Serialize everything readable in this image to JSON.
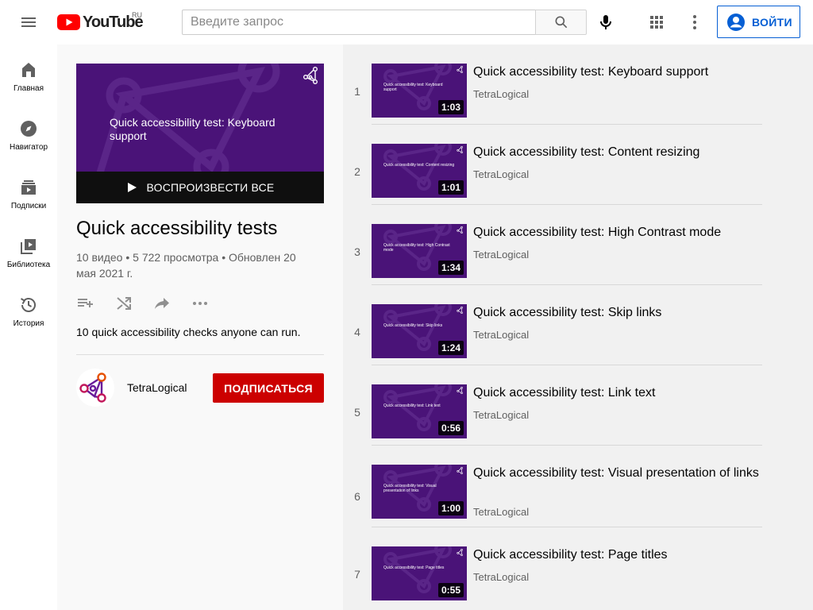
{
  "header": {
    "logo_text": "YouTube",
    "logo_region": "RU",
    "search_placeholder": "Введите запрос",
    "signin_label": "ВОЙТИ"
  },
  "guide": {
    "items": [
      {
        "label": "Главная",
        "icon": "home-icon"
      },
      {
        "label": "Навигатор",
        "icon": "compass-icon"
      },
      {
        "label": "Подписки",
        "icon": "subscriptions-icon"
      },
      {
        "label": "Библиотека",
        "icon": "library-icon"
      },
      {
        "label": "История",
        "icon": "history-icon"
      }
    ]
  },
  "playlist": {
    "thumb_text": "Quick accessibility test: Keyboard support",
    "play_all_label": "ВОСПРОИЗВЕСТИ ВСЕ",
    "title": "Quick accessibility tests",
    "stats": "10 видео • 5 722 просмотра • Обновлен 20 мая 2021 г.",
    "description": "10 quick accessibility checks anyone can run.",
    "owner_name": "TetraLogical",
    "subscribe_label": "ПОДПИСАТЬСЯ",
    "colors": {
      "thumb_bg": "#4a1378",
      "subscribe": "#cc0000",
      "accent": "#065fd4"
    }
  },
  "videos": [
    {
      "index": "1",
      "title": "Quick accessibility test: Keyboard support",
      "channel": "TetraLogical",
      "duration": "1:03",
      "thumb_text": "Quick accessibility test: Keyboard support"
    },
    {
      "index": "2",
      "title": "Quick accessibility test: Content resizing",
      "channel": "TetraLogical",
      "duration": "1:01",
      "thumb_text": "Quick accessibility test: Content resizing"
    },
    {
      "index": "3",
      "title": "Quick accessibility test: High Contrast mode",
      "channel": "TetraLogical",
      "duration": "1:34",
      "thumb_text": "Quick accessibility test: High Contrast mode"
    },
    {
      "index": "4",
      "title": "Quick accessibility test: Skip links",
      "channel": "TetraLogical",
      "duration": "1:24",
      "thumb_text": "Quick accessibility test: Skip links"
    },
    {
      "index": "5",
      "title": "Quick accessibility test: Link text",
      "channel": "TetraLogical",
      "duration": "0:56",
      "thumb_text": "Quick accessibility test: Link text"
    },
    {
      "index": "6",
      "title": "Quick accessibility test: Visual presentation of links",
      "channel": "TetraLogical",
      "duration": "1:00",
      "thumb_text": "Quick accessibility test: Visual presentation of links"
    },
    {
      "index": "7",
      "title": "Quick accessibility test: Page titles",
      "channel": "TetraLogical",
      "duration": "0:55",
      "thumb_text": "Quick accessibility test: Page titles"
    }
  ]
}
